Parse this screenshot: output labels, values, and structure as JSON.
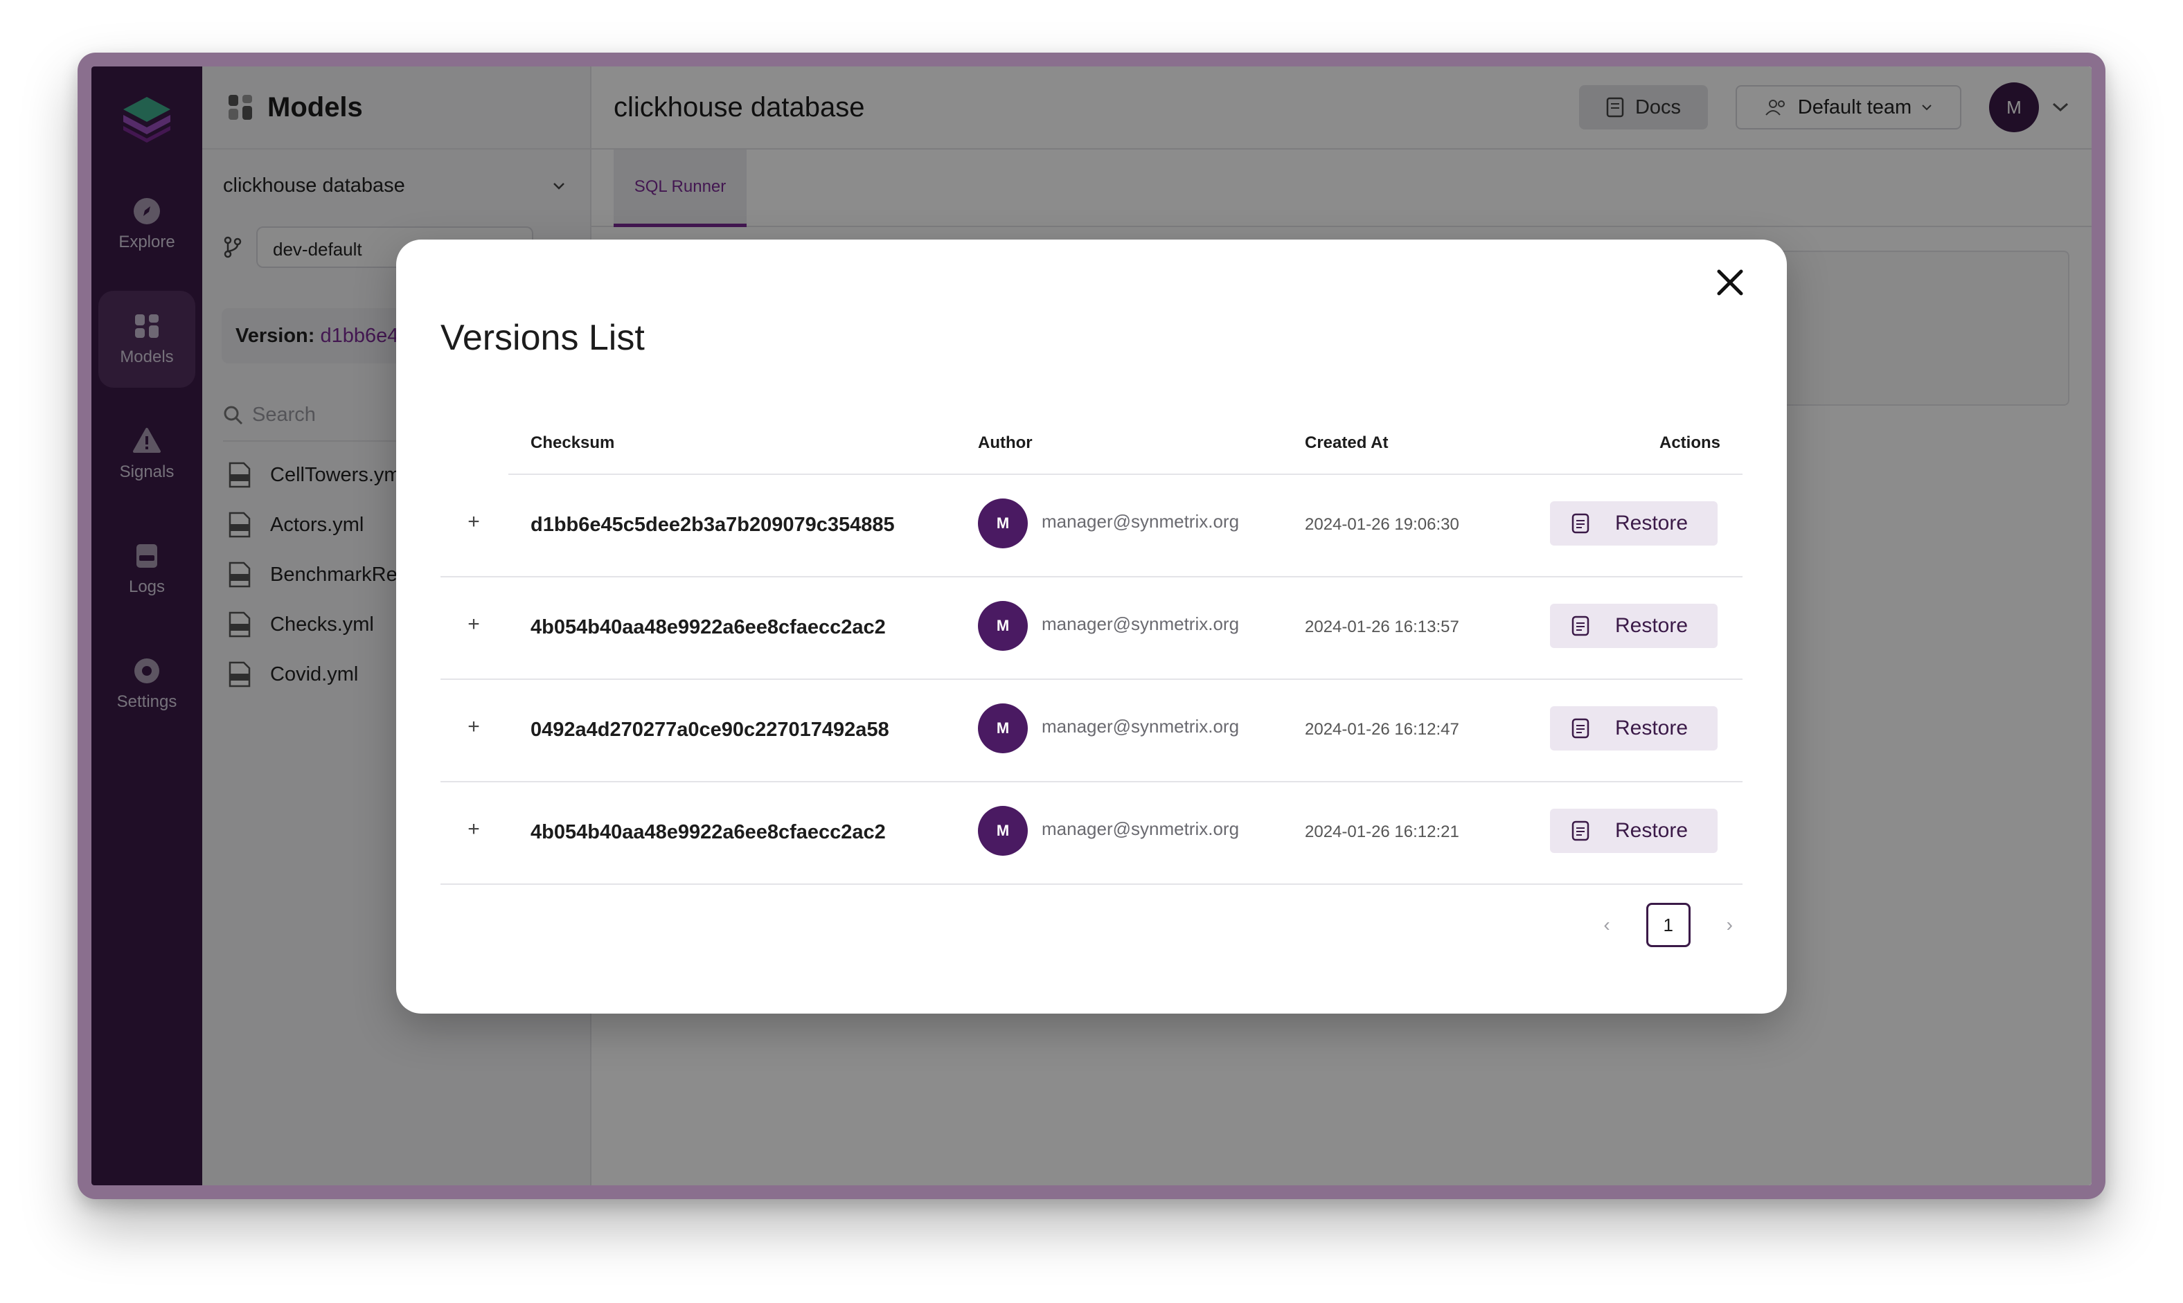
{
  "rail": {
    "items": [
      {
        "label": "Explore",
        "icon": "compass-icon"
      },
      {
        "label": "Models",
        "icon": "grid-icon"
      },
      {
        "label": "Signals",
        "icon": "warning-icon"
      },
      {
        "label": "Logs",
        "icon": "logs-icon"
      },
      {
        "label": "Settings",
        "icon": "gear-icon"
      }
    ]
  },
  "panel": {
    "title": "Models",
    "database": "clickhouse database",
    "branch": "dev-default",
    "version_label": "Version:",
    "version_hash": "d1bb6e4",
    "search_placeholder": "Search",
    "files": [
      "CellTowers.yml",
      "Actors.yml",
      "BenchmarkRe",
      "Checks.yml",
      "Covid.yml"
    ]
  },
  "main": {
    "title": "clickhouse database",
    "docs_label": "Docs",
    "team_label": "Default team",
    "user_initial": "M",
    "tab": "SQL Runner"
  },
  "modal": {
    "title": "Versions List",
    "columns": {
      "checksum": "Checksum",
      "author": "Author",
      "created_at": "Created At",
      "actions": "Actions"
    },
    "rows": [
      {
        "checksum": "d1bb6e45c5dee2b3a7b209079c354885",
        "initial": "M",
        "email": "manager@synmetrix.org",
        "created": "2024-01-26 19:06:30",
        "action": "Restore"
      },
      {
        "checksum": "4b054b40aa48e9922a6ee8cfaecc2ac2",
        "initial": "M",
        "email": "manager@synmetrix.org",
        "created": "2024-01-26 16:13:57",
        "action": "Restore"
      },
      {
        "checksum": "0492a4d270277a0ce90c227017492a58",
        "initial": "M",
        "email": "manager@synmetrix.org",
        "created": "2024-01-26 16:12:47",
        "action": "Restore"
      },
      {
        "checksum": "4b054b40aa48e9922a6ee8cfaecc2ac2",
        "initial": "M",
        "email": "manager@synmetrix.org",
        "created": "2024-01-26 16:12:21",
        "action": "Restore"
      }
    ],
    "pagination": {
      "current": "1",
      "prev": "‹",
      "next": "›"
    }
  },
  "colors": {
    "brand": "#3b1a48",
    "accent": "#7a2a94"
  }
}
